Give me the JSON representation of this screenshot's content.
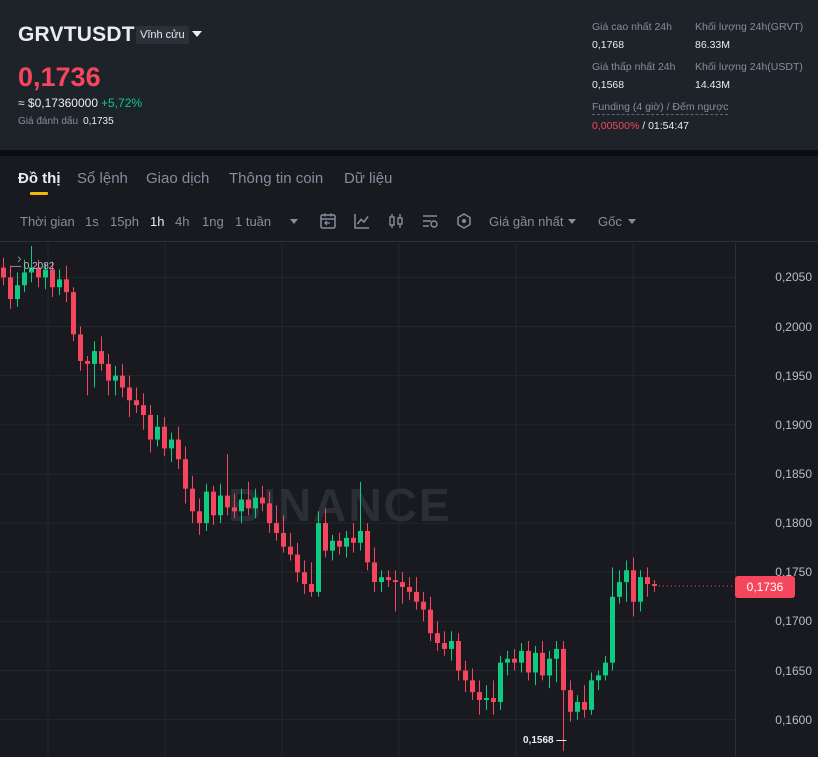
{
  "header": {
    "symbol": "GRVTUSDT",
    "contract_type": "Vĩnh cửu",
    "last_price": "0,1736",
    "usd_price": "≈ $0,17360000",
    "change_pct": "+5,72%",
    "mark_label": "Giá đánh dấu",
    "mark_price": "0,1735",
    "stats": {
      "high_label": "Giá cao nhất 24h",
      "high_value": "0,1768",
      "vol_base_label": "Khối lượng 24h(GRVT)",
      "vol_base_value": "86.33M",
      "low_label": "Giá thấp nhất 24h",
      "low_value": "0,1568",
      "vol_quote_label": "Khối lượng 24h(USDT)",
      "vol_quote_value": "14.43M",
      "funding_label": "Funding (4 giờ) / Đếm ngược",
      "funding_rate": "0,00500%",
      "funding_sep": " / ",
      "countdown": "01:54:47"
    }
  },
  "tabs": [
    "Đồ thị",
    "Sổ lệnh",
    "Giao dịch",
    "Thông tin coin",
    "Dữ liệu"
  ],
  "toolbar": {
    "time_label": "Thời gian",
    "intervals": [
      "1s",
      "15ph",
      "1h",
      "4h",
      "1ng",
      "1 tuần"
    ],
    "active_interval": "1h",
    "price_type": "Giá gần nhất",
    "mode": "Gốc"
  },
  "colors": {
    "up": "#0ecb81",
    "down": "#f6465d",
    "accent": "#f0b90b"
  },
  "chart_data": {
    "type": "candlestick",
    "watermark": "BINANCE",
    "y_ticks": [
      "0,2050",
      "0,2000",
      "0,1950",
      "0,1900",
      "0,1850",
      "0,1800",
      "0,1750",
      "0,1700",
      "0,1650",
      "0,1600"
    ],
    "ylim": [
      0.1562,
      0.2085
    ],
    "current_price_label": "0,1736",
    "high_marker": "0,2082",
    "low_marker": "0,1568",
    "candles": [
      [
        0.206,
        0.207,
        0.2042,
        0.205
      ],
      [
        0.205,
        0.2062,
        0.2018,
        0.2028
      ],
      [
        0.2028,
        0.2055,
        0.202,
        0.2042
      ],
      [
        0.2042,
        0.2068,
        0.2035,
        0.2055
      ],
      [
        0.2055,
        0.2082,
        0.2045,
        0.206
      ],
      [
        0.206,
        0.2068,
        0.204,
        0.205
      ],
      [
        0.205,
        0.2064,
        0.2038,
        0.2058
      ],
      [
        0.2058,
        0.2066,
        0.203,
        0.204
      ],
      [
        0.204,
        0.2058,
        0.2032,
        0.2048
      ],
      [
        0.2048,
        0.2062,
        0.2025,
        0.2035
      ],
      [
        0.2035,
        0.204,
        0.1985,
        0.1992
      ],
      [
        0.1992,
        0.2,
        0.1955,
        0.1965
      ],
      [
        0.1965,
        0.197,
        0.193,
        0.1962
      ],
      [
        0.1962,
        0.1985,
        0.1938,
        0.1975
      ],
      [
        0.1975,
        0.199,
        0.1955,
        0.1962
      ],
      [
        0.1962,
        0.1972,
        0.193,
        0.1945
      ],
      [
        0.1945,
        0.196,
        0.193,
        0.195
      ],
      [
        0.195,
        0.1962,
        0.1928,
        0.1938
      ],
      [
        0.1938,
        0.195,
        0.1908,
        0.1925
      ],
      [
        0.1925,
        0.1938,
        0.1912,
        0.192
      ],
      [
        0.192,
        0.1932,
        0.1895,
        0.191
      ],
      [
        0.191,
        0.192,
        0.1872,
        0.1885
      ],
      [
        0.1885,
        0.191,
        0.1878,
        0.1898
      ],
      [
        0.1898,
        0.1908,
        0.1868,
        0.1876
      ],
      [
        0.1876,
        0.1892,
        0.1862,
        0.1885
      ],
      [
        0.1885,
        0.1898,
        0.1855,
        0.1865
      ],
      [
        0.1865,
        0.1878,
        0.182,
        0.1835
      ],
      [
        0.1835,
        0.1848,
        0.18,
        0.1812
      ],
      [
        0.1812,
        0.1825,
        0.1788,
        0.18
      ],
      [
        0.18,
        0.184,
        0.1792,
        0.1832
      ],
      [
        0.1832,
        0.1838,
        0.1798,
        0.1808
      ],
      [
        0.1808,
        0.184,
        0.18,
        0.1828
      ],
      [
        0.1828,
        0.187,
        0.1808,
        0.1816
      ],
      [
        0.1816,
        0.183,
        0.1805,
        0.1812
      ],
      [
        0.1812,
        0.1835,
        0.18,
        0.1824
      ],
      [
        0.1824,
        0.1842,
        0.1808,
        0.1815
      ],
      [
        0.1815,
        0.1835,
        0.1805,
        0.1826
      ],
      [
        0.1826,
        0.1838,
        0.1812,
        0.182
      ],
      [
        0.182,
        0.1832,
        0.179,
        0.18
      ],
      [
        0.18,
        0.1818,
        0.1782,
        0.179
      ],
      [
        0.179,
        0.1808,
        0.177,
        0.1776
      ],
      [
        0.1776,
        0.179,
        0.1762,
        0.1768
      ],
      [
        0.1768,
        0.178,
        0.174,
        0.175
      ],
      [
        0.175,
        0.1762,
        0.1728,
        0.1738
      ],
      [
        0.1738,
        0.176,
        0.1725,
        0.173
      ],
      [
        0.173,
        0.1812,
        0.1725,
        0.18
      ],
      [
        0.18,
        0.1815,
        0.1765,
        0.1772
      ],
      [
        0.1772,
        0.1788,
        0.1762,
        0.1782
      ],
      [
        0.1782,
        0.179,
        0.1768,
        0.1776
      ],
      [
        0.1776,
        0.1792,
        0.1765,
        0.1785
      ],
      [
        0.1785,
        0.18,
        0.177,
        0.178
      ],
      [
        0.178,
        0.1842,
        0.1772,
        0.1792
      ],
      [
        0.1792,
        0.18,
        0.1752,
        0.176
      ],
      [
        0.176,
        0.1775,
        0.173,
        0.174
      ],
      [
        0.174,
        0.1752,
        0.173,
        0.1745
      ],
      [
        0.1745,
        0.1752,
        0.1735,
        0.1742
      ],
      [
        0.1742,
        0.1752,
        0.171,
        0.174
      ],
      [
        0.174,
        0.175,
        0.1718,
        0.1735
      ],
      [
        0.1735,
        0.1745,
        0.1722,
        0.173
      ],
      [
        0.173,
        0.1745,
        0.1712,
        0.172
      ],
      [
        0.172,
        0.173,
        0.17,
        0.1712
      ],
      [
        0.1712,
        0.1725,
        0.168,
        0.1688
      ],
      [
        0.1688,
        0.17,
        0.167,
        0.1678
      ],
      [
        0.1678,
        0.169,
        0.1665,
        0.1672
      ],
      [
        0.1672,
        0.169,
        0.166,
        0.168
      ],
      [
        0.168,
        0.1688,
        0.164,
        0.165
      ],
      [
        0.165,
        0.166,
        0.1628,
        0.164
      ],
      [
        0.164,
        0.1652,
        0.162,
        0.1628
      ],
      [
        0.1628,
        0.164,
        0.1605,
        0.162
      ],
      [
        0.162,
        0.1635,
        0.161,
        0.1622
      ],
      [
        0.1622,
        0.164,
        0.1605,
        0.1618
      ],
      [
        0.1618,
        0.1665,
        0.161,
        0.1658
      ],
      [
        0.1658,
        0.167,
        0.1645,
        0.1662
      ],
      [
        0.1662,
        0.1672,
        0.165,
        0.1658
      ],
      [
        0.1658,
        0.1678,
        0.1648,
        0.167
      ],
      [
        0.167,
        0.168,
        0.164,
        0.1648
      ],
      [
        0.1648,
        0.1675,
        0.1635,
        0.1668
      ],
      [
        0.1668,
        0.168,
        0.164,
        0.1645
      ],
      [
        0.1645,
        0.167,
        0.1632,
        0.1662
      ],
      [
        0.1662,
        0.168,
        0.1638,
        0.1672
      ],
      [
        0.1672,
        0.168,
        0.1568,
        0.163
      ],
      [
        0.163,
        0.164,
        0.1598,
        0.1608
      ],
      [
        0.1608,
        0.1625,
        0.16,
        0.1618
      ],
      [
        0.1618,
        0.1635,
        0.1602,
        0.161
      ],
      [
        0.161,
        0.1648,
        0.1605,
        0.164
      ],
      [
        0.164,
        0.165,
        0.163,
        0.1645
      ],
      [
        0.1645,
        0.1665,
        0.164,
        0.1658
      ],
      [
        0.1658,
        0.1755,
        0.165,
        0.1725
      ],
      [
        0.1725,
        0.1752,
        0.1718,
        0.174
      ],
      [
        0.174,
        0.1762,
        0.172,
        0.1752
      ],
      [
        0.1752,
        0.1765,
        0.1705,
        0.172
      ],
      [
        0.172,
        0.1752,
        0.171,
        0.1745
      ],
      [
        0.1745,
        0.1755,
        0.1725,
        0.1738
      ],
      [
        0.1738,
        0.1742,
        0.173,
        0.1736
      ]
    ]
  }
}
